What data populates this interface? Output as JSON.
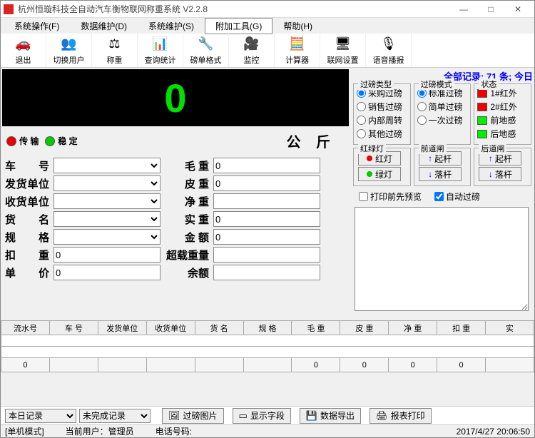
{
  "window": {
    "title": "杭州恒璇科技全自动汽车衡物联网称重系统 V2.2.8"
  },
  "menu": {
    "items": [
      "系统操作(F)",
      "数据维护(D)",
      "系统维护(S)",
      "附加工具(G)",
      "帮助(H)"
    ]
  },
  "toolbar": {
    "items": [
      {
        "icon": "🚗",
        "label": "退出"
      },
      {
        "icon": "👥",
        "label": "切换用户"
      },
      {
        "icon": "⚖",
        "label": "称重"
      },
      {
        "icon": "📊",
        "label": "查询统计"
      },
      {
        "icon": "🔧",
        "label": "磅单格式"
      },
      {
        "icon": "🎥",
        "label": "监控"
      },
      {
        "icon": "🧮",
        "label": "计算器"
      },
      {
        "icon": "🖥",
        "label": "联网设置"
      },
      {
        "icon": "🎙",
        "label": "语音播报"
      }
    ]
  },
  "display": {
    "value": "0"
  },
  "statusrow": {
    "transfer": "传 输",
    "stable": "稳 定",
    "unit": "公 斤"
  },
  "form_left": [
    {
      "label": "车 号",
      "type": "select",
      "value": ""
    },
    {
      "label": "发货单位",
      "type": "select",
      "value": ""
    },
    {
      "label": "收货单位",
      "type": "select",
      "value": ""
    },
    {
      "label": "货 名",
      "type": "select",
      "value": ""
    },
    {
      "label": "规 格",
      "type": "select",
      "value": ""
    },
    {
      "label": "扣 重",
      "type": "input",
      "value": "0"
    },
    {
      "label": "单 价",
      "type": "input",
      "value": "0"
    }
  ],
  "form_right": [
    {
      "label": "毛 重",
      "value": "0"
    },
    {
      "label": "皮 重",
      "value": "0"
    },
    {
      "label": "净 重",
      "value": ""
    },
    {
      "label": "实 重",
      "value": "0"
    },
    {
      "label": "金 额",
      "value": "0"
    },
    {
      "label": "超载重量",
      "value": ""
    },
    {
      "label": "余额",
      "value": ""
    }
  ],
  "records_line": "全部记录: 71 条; 今日",
  "groups": {
    "type": {
      "title": "过磅类型",
      "opts": [
        "采购过磅",
        "销售过磅",
        "内部周转",
        "其他过磅"
      ],
      "selected": 0
    },
    "mode": {
      "title": "过磅模式",
      "opts": [
        "标准过磅",
        "简单过磅",
        "一次过磅"
      ],
      "selected": 0
    },
    "status": {
      "title": "状态",
      "items": [
        {
          "color": "red",
          "label": "1#红外"
        },
        {
          "color": "red",
          "label": "2#红外"
        },
        {
          "color": "green",
          "label": "前地感"
        },
        {
          "color": "green",
          "label": "后地感"
        }
      ]
    },
    "light": {
      "title": "红绿灯",
      "btns": [
        {
          "dot": "red",
          "label": "红灯"
        },
        {
          "dot": "green",
          "label": "绿灯"
        }
      ]
    },
    "front": {
      "title": "前道闸",
      "btns": [
        {
          "arrow": "↑",
          "label": "起杆"
        },
        {
          "arrow": "↓",
          "label": "落杆"
        }
      ]
    },
    "back": {
      "title": "后道闸",
      "btns": [
        {
          "arrow": "↑",
          "label": "起杆"
        },
        {
          "arrow": "↓",
          "label": "落杆"
        }
      ]
    }
  },
  "checks": {
    "preview": "打印前先预览",
    "auto": "自动过磅"
  },
  "grid": {
    "headers": [
      "流水号",
      "车 号",
      "发货单位",
      "收货单位",
      "货 名",
      "规 格",
      "毛 重",
      "皮 重",
      "净 重",
      "扣 重",
      "实"
    ],
    "sumrow": [
      "0",
      "",
      "",
      "",
      "",
      "",
      "0",
      "0",
      "0",
      "0",
      ""
    ]
  },
  "bottom": {
    "sel1": "本日记录",
    "sel2": "未完成记录",
    "btns": [
      {
        "icon": "🖼",
        "label": "过磅图片"
      },
      {
        "icon": "▭",
        "label": "显示字段"
      },
      {
        "icon": "💾",
        "label": "数据导出"
      },
      {
        "icon": "🖨",
        "label": "报表打印"
      }
    ]
  },
  "statusbar": {
    "mode": "[单机模式]",
    "user": "当前用户：管理员",
    "phone": "电话号码:",
    "datetime": "2017/4/27 20:06:50"
  }
}
